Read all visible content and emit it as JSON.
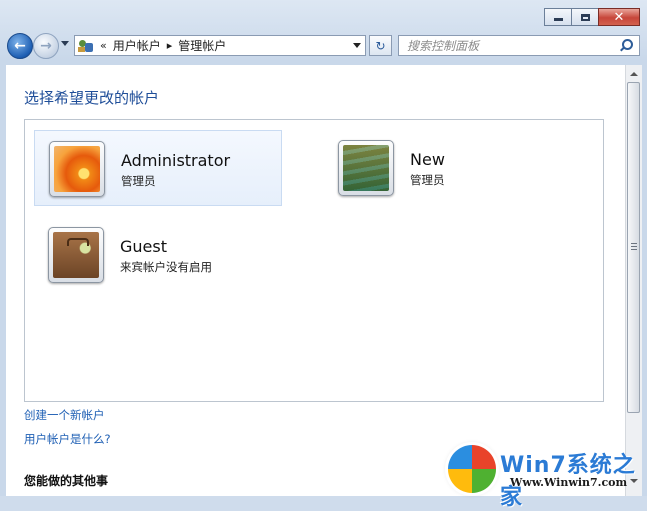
{
  "window": {
    "caption": {
      "minimize": "–",
      "maximize": "□",
      "close": "✕"
    }
  },
  "nav": {
    "back": "←",
    "forward": "→",
    "breadcrumb_overflow": "«",
    "breadcrumb": [
      "用户帐户",
      "管理帐户"
    ],
    "crumb_separator": "▸",
    "refresh": "↻",
    "search_placeholder": "搜索控制面板"
  },
  "content": {
    "heading": "选择希望更改的帐户",
    "accounts": [
      {
        "name": "Administrator",
        "type": "管理员",
        "picture": "flower-picture",
        "selected": true
      },
      {
        "name": "New",
        "type": "管理员",
        "picture": "stairs-picture",
        "selected": false
      },
      {
        "name": "Guest",
        "type": "来宾帐户没有启用",
        "picture": "suitcase-picture",
        "selected": false
      }
    ],
    "links": {
      "create_account": "创建一个新帐户",
      "what_is_account": "用户帐户是什么?"
    },
    "other_tasks_heading": "您能做的其他事"
  },
  "watermark": {
    "title": "Win7系统之家",
    "url": "Www.Winwin7.com"
  },
  "colors": {
    "heading": "#1f4e99",
    "link": "#1e5fb4",
    "selection": "#e6effb"
  }
}
